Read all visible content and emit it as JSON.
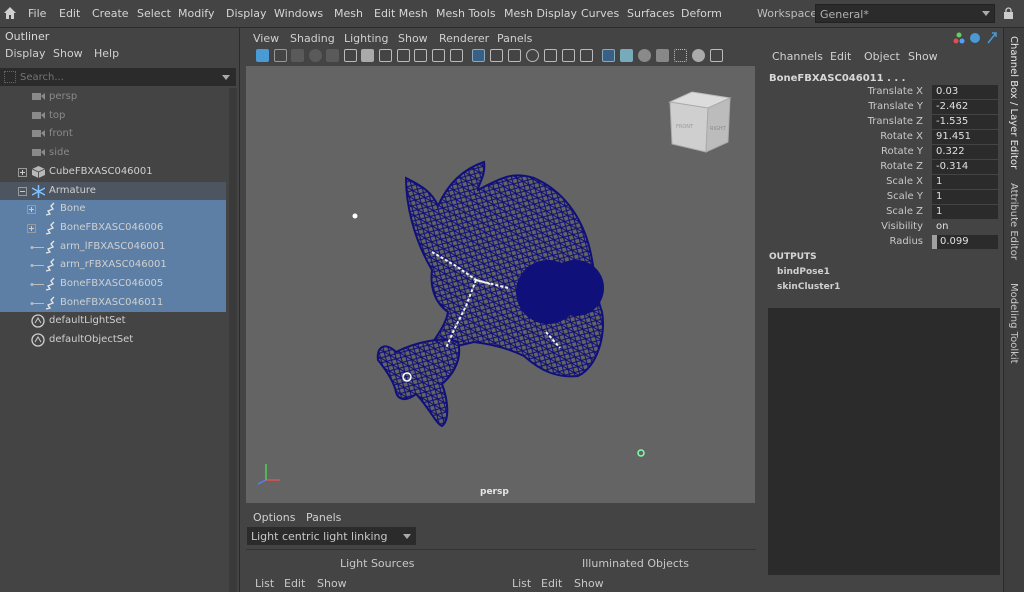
{
  "menubar": {
    "items": [
      "File",
      "Edit",
      "Create",
      "Select",
      "Modify",
      "Display",
      "Windows",
      "Mesh",
      "Edit Mesh",
      "Mesh Tools",
      "Mesh Display",
      "Curves",
      "Surfaces",
      "Deform"
    ],
    "workspace_label": "Workspace:",
    "workspace_value": "General*"
  },
  "outliner": {
    "title": "Outliner",
    "menu": [
      "Display",
      "Show",
      "Help"
    ],
    "search_placeholder": "Search...",
    "nodes": [
      {
        "label": "persp",
        "kind": "camera"
      },
      {
        "label": "top",
        "kind": "camera"
      },
      {
        "label": "front",
        "kind": "camera"
      },
      {
        "label": "side",
        "kind": "camera"
      },
      {
        "label": "CubeFBXASC046001",
        "kind": "mesh"
      },
      {
        "label": "Armature",
        "kind": "armature"
      },
      {
        "label": "Bone",
        "kind": "bone"
      },
      {
        "label": "BoneFBXASC046006",
        "kind": "bone"
      },
      {
        "label": "arm_lFBXASC046001",
        "kind": "bone"
      },
      {
        "label": "arm_rFBXASC046001",
        "kind": "bone"
      },
      {
        "label": "BoneFBXASC046005",
        "kind": "bone"
      },
      {
        "label": "BoneFBXASC046011",
        "kind": "bone"
      },
      {
        "label": "defaultLightSet",
        "kind": "set"
      },
      {
        "label": "defaultObjectSet",
        "kind": "set"
      }
    ]
  },
  "viewport": {
    "menu": [
      "View",
      "Shading",
      "Lighting",
      "Show",
      "Renderer",
      "Panels"
    ],
    "camera_label": "persp",
    "viewcube": {
      "front": "FRONT",
      "right": "RIGHT"
    },
    "mesh_color": "#10107a"
  },
  "light_linking": {
    "menu": [
      "Options",
      "Panels"
    ],
    "mode": "Light centric light linking",
    "light_sources": "Light Sources",
    "illuminated_objects": "Illuminated Objects",
    "left_menu": [
      "List",
      "Edit",
      "Show"
    ],
    "right_menu": [
      "List",
      "Edit",
      "Show"
    ]
  },
  "channel_box": {
    "menu": [
      "Channels",
      "Edit",
      "Object",
      "Show"
    ],
    "object_name": "BoneFBXASC046011 . . .",
    "attributes": [
      {
        "label": "Translate X",
        "value": "0.03"
      },
      {
        "label": "Translate Y",
        "value": "-2.462"
      },
      {
        "label": "Translate Z",
        "value": "-1.535"
      },
      {
        "label": "Rotate X",
        "value": "91.451"
      },
      {
        "label": "Rotate Y",
        "value": "0.322"
      },
      {
        "label": "Rotate Z",
        "value": "-0.314"
      },
      {
        "label": "Scale X",
        "value": "1"
      },
      {
        "label": "Scale Y",
        "value": "1"
      },
      {
        "label": "Scale Z",
        "value": "1"
      },
      {
        "label": "Visibility",
        "value": "on"
      },
      {
        "label": "Radius",
        "value": "0.099"
      }
    ],
    "outputs_label": "OUTPUTS",
    "outputs": [
      "bindPose1",
      "skinCluster1"
    ]
  },
  "side_tabs": [
    "Channel Box / Layer Editor",
    "Attribute Editor",
    "Modeling Toolkit"
  ],
  "colors": {
    "selection": "#5d7fa6",
    "accent": "#4a9ad6",
    "mesh": "#10107a"
  }
}
